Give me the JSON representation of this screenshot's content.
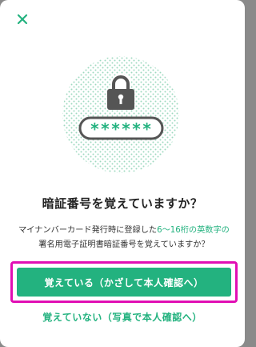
{
  "dialog": {
    "close_icon": "close-icon",
    "title": "暗証番号を覚えていますか？",
    "description_part1": "マイナンバーカード発行時に登録した",
    "description_highlight": "6〜16桁の英数字の",
    "description_part2": "署名用電子証明書暗証番号",
    "description_part3": "を覚えていますか？",
    "password_mask": "******",
    "primary_button_label": "覚えている（かざして本人確認へ）",
    "secondary_link_label": "覚えていない（写真で本人確認へ）"
  },
  "colors": {
    "accent": "#23b27f",
    "highlight_border": "#e10fb4"
  }
}
